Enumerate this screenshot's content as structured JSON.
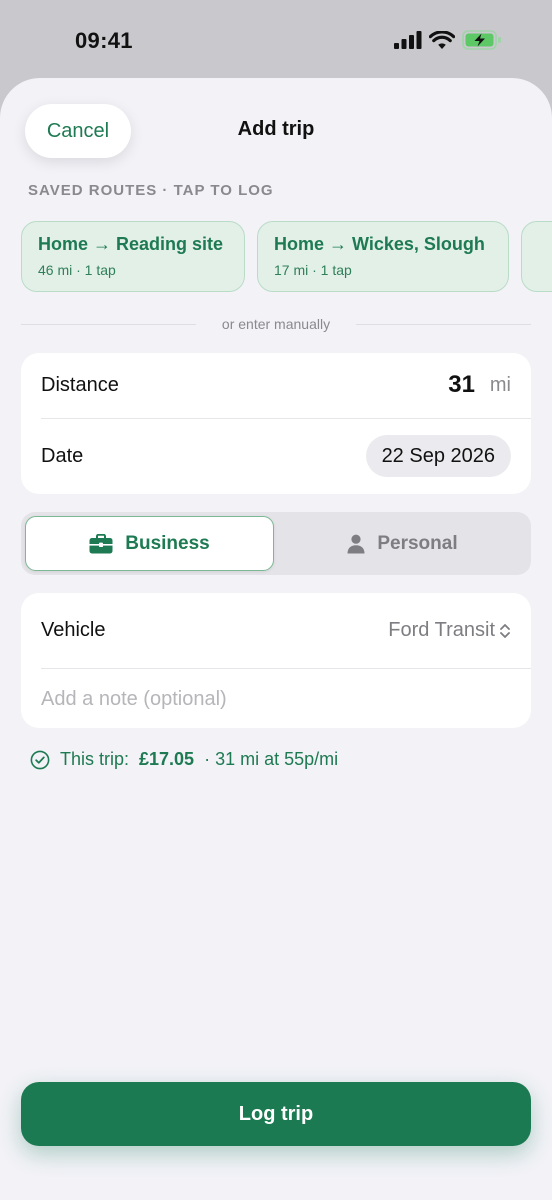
{
  "status_bar": {
    "time": "09:41"
  },
  "header": {
    "cancel_label": "Cancel",
    "title": "Add trip"
  },
  "saved_routes": {
    "label": "SAVED ROUTES · TAP TO LOG",
    "items": [
      {
        "title": "Home → Reading site",
        "sub": "46 mi · 1 tap"
      },
      {
        "title": "Home → Wickes, Slough",
        "sub": "17 mi · 1 tap"
      }
    ]
  },
  "divider_text": "or enter manually",
  "trip": {
    "distance_label": "Distance",
    "distance_value": "31",
    "distance_unit": "mi",
    "date_label": "Date",
    "date_value": "22 Sep 2026"
  },
  "trip_type": {
    "options": [
      {
        "label": "Business",
        "icon": "briefcase-icon",
        "selected": true
      },
      {
        "label": "Personal",
        "icon": "person-icon",
        "selected": false
      }
    ]
  },
  "details": {
    "vehicle_label": "Vehicle",
    "vehicle_value": "Ford Transit",
    "note_placeholder": "Add a note (optional)"
  },
  "summary": {
    "prefix": "This trip:",
    "amount": "£17.05",
    "detail": "· 31 mi at 55p/mi"
  },
  "log_button_label": "Log trip",
  "colors": {
    "accent": "#1b7a52",
    "chip_bg": "#e3f0e8",
    "sheet_bg": "#f2f2f7"
  }
}
